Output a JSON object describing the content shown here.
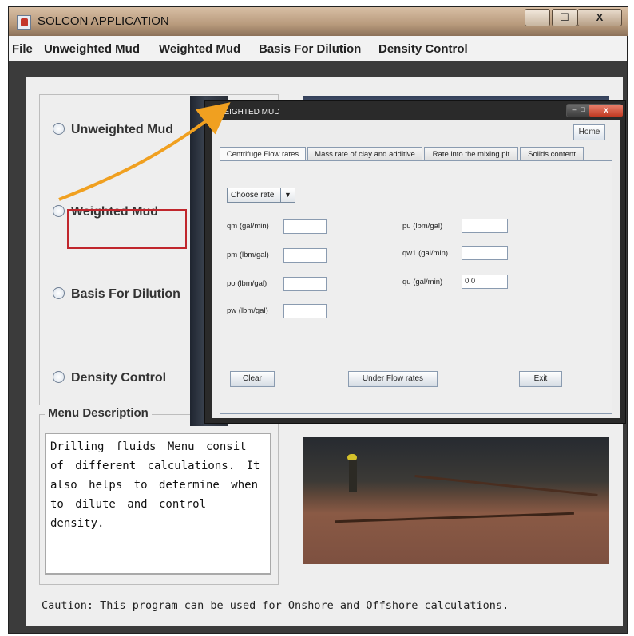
{
  "window": {
    "title": "SOLCON APPLICATION",
    "controls": {
      "minimize": "—",
      "maximize": "☐",
      "close": "X"
    }
  },
  "menu": [
    "File",
    "Unweighted Mud",
    "Weighted Mud",
    "Basis For Dilution",
    "Density Control"
  ],
  "radio_options": [
    {
      "label": "Unweighted Mud"
    },
    {
      "label": "Weighted Mud"
    },
    {
      "label": "Basis For Dilution"
    },
    {
      "label": "Density Control"
    }
  ],
  "menu_description": {
    "legend": "Menu Description",
    "text": "Drilling fluids Menu consit of different calculations. It also helps to determine when to dilute and control density."
  },
  "caution": "Caution: This program can be used for Onshore and Offshore calculations.",
  "dialog": {
    "title": "WEIGHTED MUD",
    "home_label": "Home",
    "tabs": [
      "Centrifuge Flow rates",
      "Mass rate of clay and additive",
      "Rate into the mixing pit",
      "Solids content"
    ],
    "combo": "Choose rate",
    "left_fields": [
      {
        "label": "qm (gal/min)",
        "value": ""
      },
      {
        "label": "pm (lbm/gal)",
        "value": ""
      },
      {
        "label": "po (lbm/gal)",
        "value": ""
      },
      {
        "label": "pw (lbm/gal)",
        "value": ""
      }
    ],
    "right_fields": [
      {
        "label": "pu (lbm/gal)",
        "value": ""
      },
      {
        "label": "qw1 (gal/min)",
        "value": ""
      },
      {
        "label": "qu (gal/min)",
        "value": "0.0"
      }
    ],
    "buttons": {
      "clear": "Clear",
      "under": "Under Flow rates",
      "exit": "Exit"
    }
  },
  "colors": {
    "highlight": "#c0262c",
    "arrow": "#f0a020"
  }
}
